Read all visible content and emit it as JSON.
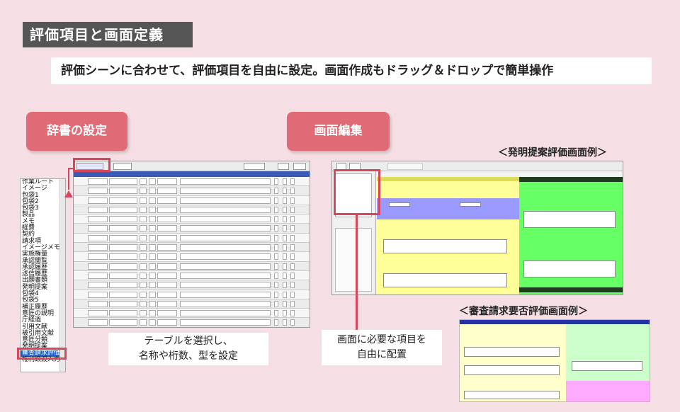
{
  "header": {
    "title": "評価項目と画面定義",
    "subtitle": "評価シーンに合わせて、評価項目を自由に設定。画面作成もドラッグ＆ドロップで簡単操作"
  },
  "sections": {
    "dictionary": {
      "label": "辞書の設定",
      "caption_line1": "テーブルを選択し、",
      "caption_line2": "名称や桁数、型を設定"
    },
    "screen": {
      "label": "画面編集",
      "caption_line1": "画面に必要な項目を",
      "caption_line2": "自由に配置"
    }
  },
  "examples": {
    "invention": "＜発明提案評価画面例＞",
    "examination": "＜審査請求要否評価画面例＞"
  },
  "table_list": {
    "items": [
      "作業ルート",
      "イメージ",
      "包袋1",
      "包袋2",
      "包袋3",
      "製品",
      "メモ",
      "経費",
      "契約",
      "請求項",
      "イメージメモ",
      "実施権量",
      "承認閲覧",
      "承認履歴",
      "送信履歴",
      "出願書類",
      "発明提案",
      "包袋4",
      "包袋5",
      "補正履歴",
      "意匠の説明",
      "庁経過",
      "引用文献",
      "被引用文献",
      "意匠分類",
      "発明提案",
      "審査請求評価",
      "権利譲渡入力"
    ],
    "selected_index": 26
  },
  "colors": {
    "accent": "#e06a76",
    "frame": "#d9455a",
    "title_bg": "#555555"
  }
}
